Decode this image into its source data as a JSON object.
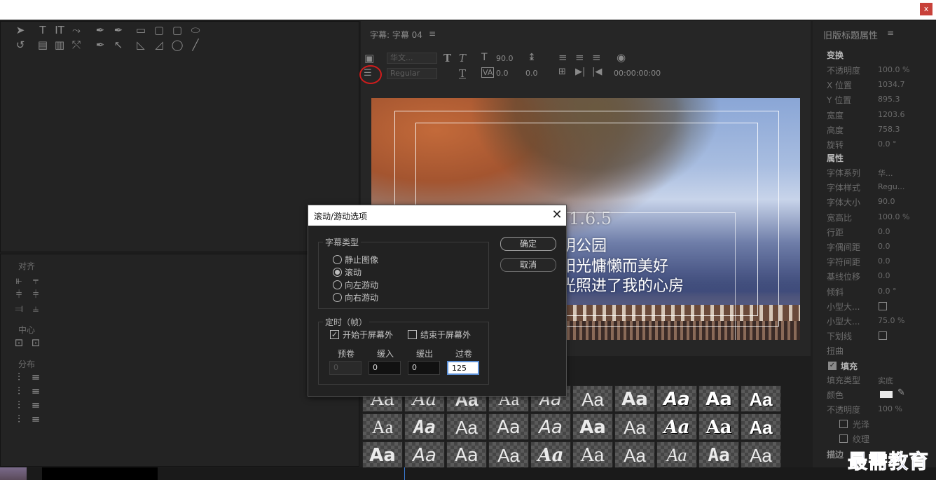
{
  "window": {
    "close_label": "x"
  },
  "title_panel": {
    "title": "字幕: 字幕 04",
    "menu_icon": "≡",
    "font_family": "华文...",
    "font_style": "Regular",
    "font_size": "90.0",
    "kerning": "0.0",
    "leading": "0.0",
    "timecode": "00:00:00:00"
  },
  "canvas": {
    "line1": "1.6.5",
    "line2": "阴公园",
    "line3": "阳光慵懒而美好",
    "line4": "光照进了我的心房"
  },
  "left_panel": {
    "align_label": "对齐",
    "center_label": "中心",
    "distribute_label": "分布"
  },
  "right_panel": {
    "title": "旧版标题属性",
    "transform_header": "变换",
    "transform": [
      {
        "label": "不透明度",
        "value": "100.0 %"
      },
      {
        "label": "X 位置",
        "value": "1034.7"
      },
      {
        "label": "Y 位置",
        "value": "895.3"
      },
      {
        "label": "宽度",
        "value": "1203.6"
      },
      {
        "label": "高度",
        "value": "758.3"
      },
      {
        "label": "旋转",
        "value": "0.0 °"
      }
    ],
    "props_header": "属性",
    "props": [
      {
        "label": "字体系列",
        "value": "华..."
      },
      {
        "label": "字体样式",
        "value": "Regu..."
      },
      {
        "label": "字体大小",
        "value": "90.0"
      },
      {
        "label": "宽高比",
        "value": "100.0 %"
      },
      {
        "label": "行距",
        "value": "0.0"
      },
      {
        "label": "字偶间距",
        "value": "0.0"
      },
      {
        "label": "字符间距",
        "value": "0.0"
      },
      {
        "label": "基线位移",
        "value": "0.0"
      },
      {
        "label": "倾斜",
        "value": "0.0 °"
      },
      {
        "label": "小型大...",
        "value": ""
      },
      {
        "label": "小型大...",
        "value": "75.0 %"
      },
      {
        "label": "下划线",
        "value": ""
      },
      {
        "label": "扭曲",
        "value": ""
      }
    ],
    "fill_header": "填充",
    "fill": [
      {
        "label": "填充类型",
        "value": "实底"
      },
      {
        "label": "颜色",
        "value": ""
      },
      {
        "label": "不透明度",
        "value": "100 %"
      }
    ],
    "sheen_label": "光泽",
    "texture_label": "纹理",
    "stroke_label": "描边"
  },
  "styles": {
    "sample": "Aa"
  },
  "dialog": {
    "title": "滚动/游动选项",
    "type_group": "字幕类型",
    "options": [
      "静止图像",
      "滚动",
      "向左游动",
      "向右游动"
    ],
    "selected_index": 1,
    "timing_group": "定时（帧）",
    "start_off": "开始于屏幕外",
    "start_off_checked": true,
    "end_off": "结束于屏幕外",
    "end_off_checked": false,
    "fields": [
      {
        "label": "预卷",
        "value": "0"
      },
      {
        "label": "缓入",
        "value": "0"
      },
      {
        "label": "缓出",
        "value": "0"
      },
      {
        "label": "过卷",
        "value": "125"
      }
    ],
    "ok": "确定",
    "cancel": "取消"
  },
  "watermark": "最需教育"
}
